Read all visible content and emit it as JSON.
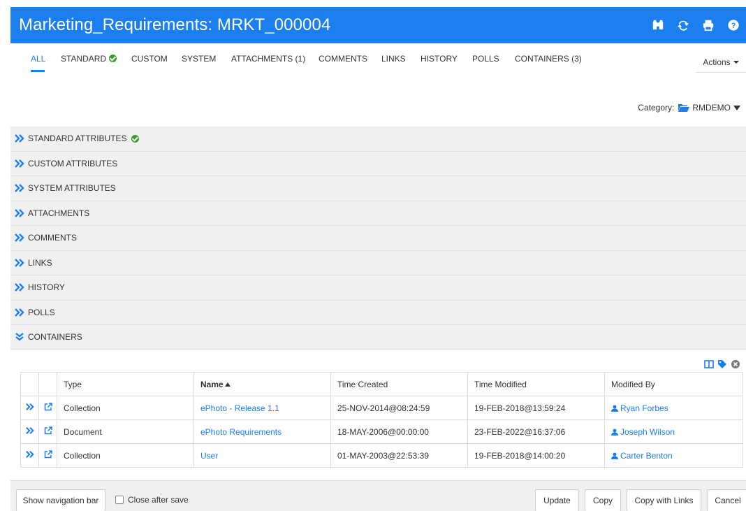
{
  "header": {
    "title": "Marketing_Requirements: MRKT_000004",
    "icons": [
      "binoculars-icon",
      "refresh-icon",
      "print-icon",
      "help-icon"
    ],
    "background": "#1c7ff0"
  },
  "tabs": [
    {
      "label": "ALL",
      "active": true
    },
    {
      "label": "STANDARD",
      "badge": "check-circle-icon"
    },
    {
      "label": "CUSTOM"
    },
    {
      "label": "SYSTEM"
    },
    {
      "label": "ATTACHMENTS (1)"
    },
    {
      "label": "COMMENTS"
    },
    {
      "label": "LINKS"
    },
    {
      "label": "HISTORY"
    },
    {
      "label": "POLLS"
    },
    {
      "label": "CONTAINERS (3)"
    }
  ],
  "actions_label": "Actions",
  "category": {
    "label": "Category:",
    "value": "RMDEMO"
  },
  "sections": [
    {
      "label": "STANDARD ATTRIBUTES",
      "expanded": false,
      "badge": "check-circle-icon"
    },
    {
      "label": "CUSTOM ATTRIBUTES",
      "expanded": false
    },
    {
      "label": "SYSTEM ATTRIBUTES",
      "expanded": false
    },
    {
      "label": "ATTACHMENTS",
      "expanded": false
    },
    {
      "label": "COMMENTS",
      "expanded": false
    },
    {
      "label": "LINKS",
      "expanded": false
    },
    {
      "label": "HISTORY",
      "expanded": false
    },
    {
      "label": "POLLS",
      "expanded": false
    },
    {
      "label": "CONTAINERS",
      "expanded": true
    }
  ],
  "table": {
    "tools": [
      "columns-icon",
      "tag-icon",
      "close-circle-icon"
    ],
    "columns": [
      "Type",
      "Name",
      "Time Created",
      "Time Modified",
      "Modified By"
    ],
    "sorted_column": "Name",
    "rows": [
      {
        "type": "Collection",
        "name": "ePhoto - Release 1.1",
        "created": "25-NOV-2014@08:24:59",
        "modified": "19-FEB-2018@13:59:24",
        "modified_by": "Ryan Forbes"
      },
      {
        "type": "Document",
        "name": "ePhoto Requirements",
        "created": "18-MAY-2006@00:00:00",
        "modified": "23-FEB-2022@16:37:06",
        "modified_by": "Joseph Wilson"
      },
      {
        "type": "Collection",
        "name": "User",
        "created": "01-MAY-2003@22:53:39",
        "modified": "19-FEB-2018@14:00:20",
        "modified_by": "Carter Benton"
      }
    ]
  },
  "footer": {
    "show_nav_label": "Show navigation bar",
    "close_after_save_label": "Close after save",
    "close_after_save_checked": false,
    "update_label": "Update",
    "copy_label": "Copy",
    "copy_links_label": "Copy with Links",
    "cancel_label": "Cancel"
  },
  "colors": {
    "accent": "#1c7ff0",
    "success": "#3a9a2e",
    "section_bg": "#f0f0f0"
  }
}
